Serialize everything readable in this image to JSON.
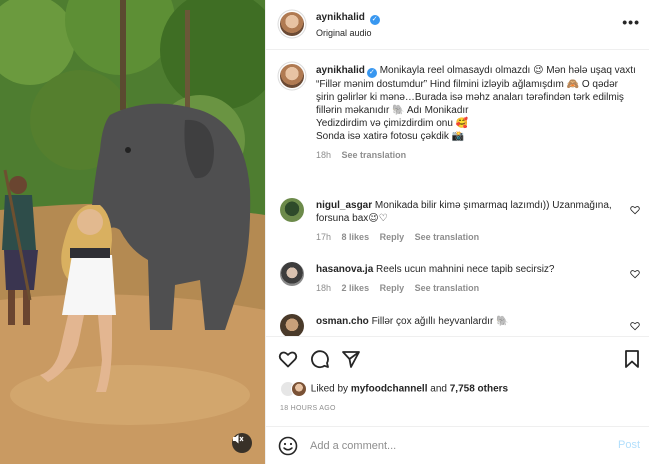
{
  "post": {
    "username": "aynikhalid",
    "audio": "Original audio",
    "more_icon": "more-horizontal-icon"
  },
  "caption": {
    "username": "aynikhalid",
    "text": "Monikayla reel olmasaydı olmazdı 😉 Mən hələ uşaq vaxtı “Fillər mənim dostumdur” Hind filmini izləyib ağlamışdım 🙈 O qədər şirin gəlirlər ki mənə…Burada isə məhz anaları tərəfindən tərk edilmiş fillərin məkanıdır 🐘 Adı Monikadır",
    "line2": "Yedizdirdim və çimizdirdim onu 🥰",
    "line3": "Sonda isə xatirə fotosu çəkdik 📸",
    "time": "18h",
    "see_translation": "See translation"
  },
  "comments": [
    {
      "username": "nigul_asgar",
      "text": "Monikada bilir kimə şımarmaq lazımdı)) Uzanmağına, forsuna bax😉♡",
      "time": "17h",
      "likes": "8 likes",
      "reply": "Reply",
      "see_translation": "See translation"
    },
    {
      "username": "hasanova.ja",
      "text": "Reels ucun mahnini nece tapib secirsiz?",
      "time": "18h",
      "likes": "2 likes",
      "reply": "Reply",
      "see_translation": "See translation"
    },
    {
      "username": "osman.cho",
      "text": "Fillər çox ağıllı heyvanlardır 🐘"
    }
  ],
  "liked_by": {
    "prefix": "Liked by",
    "user": "myfoodchannell",
    "and": "and",
    "others": "7,758 others"
  },
  "time_ago": "18 HOURS AGO",
  "add_comment": {
    "placeholder": "Add a comment...",
    "post_label": "Post"
  },
  "colors": {
    "verified": "#3897f0",
    "muted_text": "#8e8e8e",
    "post_button": "#b2dffc"
  }
}
